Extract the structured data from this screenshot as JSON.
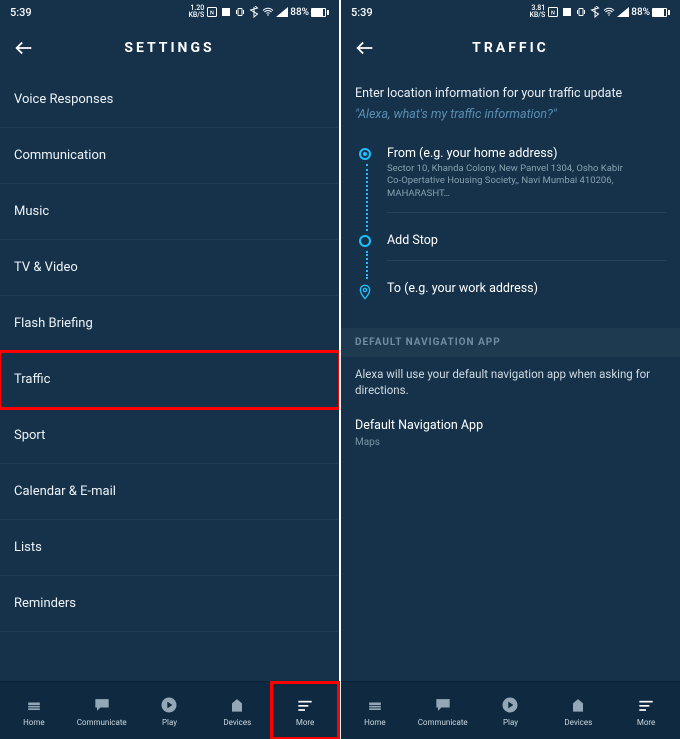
{
  "status_bar": {
    "time": "5:39",
    "net_left": "1.20",
    "net_left_unit": "KB/S",
    "net_right": "3.81",
    "net_right_unit": "KB/S",
    "battery_pct": "88%"
  },
  "left_phone": {
    "title": "SETTINGS",
    "items": [
      "Voice Responses",
      "Communication",
      "Music",
      "TV & Video",
      "Flash Briefing",
      "Traffic",
      "Sport",
      "Calendar & E-mail",
      "Lists",
      "Reminders"
    ],
    "highlight_index": 5
  },
  "right_phone": {
    "title": "TRAFFIC",
    "instruction": "Enter location information for your traffic update",
    "hint": "\"Alexa, what's my traffic information?\"",
    "from_label": "From (e.g. your home address)",
    "from_line1": "Sector 10,  Khanda Colony, New Panvel 1304, Osho Kabir",
    "from_line2": "Co-Opertative Housing Society,, Navi Mumbai 410206, MAHARASHT…",
    "add_stop": "Add Stop",
    "to_label": "To (e.g. your work address)",
    "section_header": "DEFAULT NAVIGATION APP",
    "section_desc": "Alexa will use your default navigation app when asking for directions.",
    "nav_app_label": "Default Navigation App",
    "nav_app_value": "Maps"
  },
  "tabs": {
    "home": "Home",
    "communicate": "Communicate",
    "play": "Play",
    "devices": "Devices",
    "more": "More"
  }
}
